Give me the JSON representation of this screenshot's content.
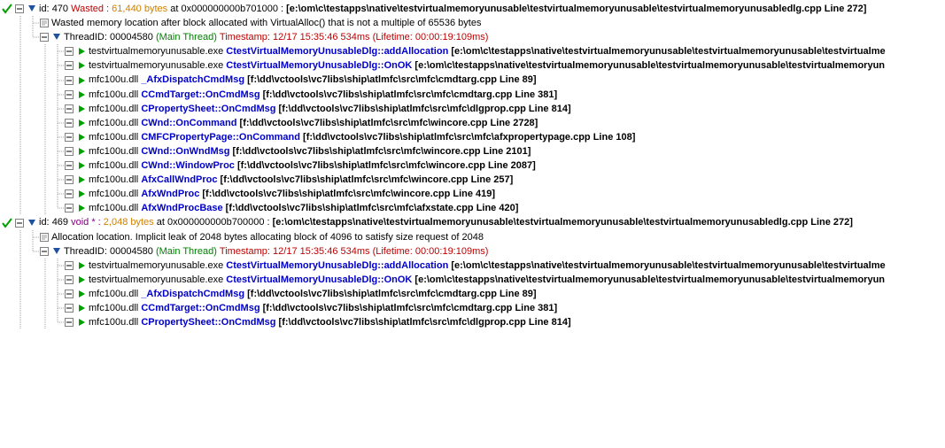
{
  "nodes": [
    {
      "id_label": "id: ",
      "id_no": "470",
      "waste_label": " Wasted : ",
      "bytes": "61,440 bytes",
      "at": " at ",
      "addr": "0x000000000b701000 : ",
      "loc": "[e:\\om\\c\\testapps\\native\\testvirtualmemoryunusable\\testvirtualmemoryunusable\\testvirtualmemoryunusabledlg.cpp Line 272]",
      "desc": "Wasted memory location after block allocated with VirtualAlloc() that is not a multiple of 65536 bytes",
      "thread_label": "ThreadID: ",
      "thread_id": "00004580",
      "thread_name": "  (Main Thread)  ",
      "ts_label": "Timestamp: ",
      "ts": "12/17 15:35:46 534ms",
      "life": " (Lifetime: 00:00:19:109ms)",
      "stack": [
        {
          "mod": "testvirtualmemoryunusable.exe ",
          "fn": "CtestVirtualMemoryUnusableDlg::addAllocation",
          "loc": "  [e:\\om\\c\\testapps\\native\\testvirtualmemoryunusable\\testvirtualmemoryunusable\\testvirtualme"
        },
        {
          "mod": "testvirtualmemoryunusable.exe ",
          "fn": "CtestVirtualMemoryUnusableDlg::OnOK",
          "loc": "  [e:\\om\\c\\testapps\\native\\testvirtualmemoryunusable\\testvirtualmemoryunusable\\testvirtualmemoryun"
        },
        {
          "mod": "mfc100u.dll ",
          "fn": "_AfxDispatchCmdMsg",
          "loc": "  [f:\\dd\\vctools\\vc7libs\\ship\\atlmfc\\src\\mfc\\cmdtarg.cpp Line 89]"
        },
        {
          "mod": "mfc100u.dll ",
          "fn": "CCmdTarget::OnCmdMsg",
          "loc": "  [f:\\dd\\vctools\\vc7libs\\ship\\atlmfc\\src\\mfc\\cmdtarg.cpp Line 381]"
        },
        {
          "mod": "mfc100u.dll ",
          "fn": "CPropertySheet::OnCmdMsg",
          "loc": "  [f:\\dd\\vctools\\vc7libs\\ship\\atlmfc\\src\\mfc\\dlgprop.cpp Line 814]"
        },
        {
          "mod": "mfc100u.dll ",
          "fn": "CWnd::OnCommand",
          "loc": "  [f:\\dd\\vctools\\vc7libs\\ship\\atlmfc\\src\\mfc\\wincore.cpp Line 2728]"
        },
        {
          "mod": "mfc100u.dll ",
          "fn": "CMFCPropertyPage::OnCommand",
          "loc": "  [f:\\dd\\vctools\\vc7libs\\ship\\atlmfc\\src\\mfc\\afxpropertypage.cpp Line 108]"
        },
        {
          "mod": "mfc100u.dll ",
          "fn": "CWnd::OnWndMsg",
          "loc": "  [f:\\dd\\vctools\\vc7libs\\ship\\atlmfc\\src\\mfc\\wincore.cpp Line 2101]"
        },
        {
          "mod": "mfc100u.dll ",
          "fn": "CWnd::WindowProc",
          "loc": "  [f:\\dd\\vctools\\vc7libs\\ship\\atlmfc\\src\\mfc\\wincore.cpp Line 2087]"
        },
        {
          "mod": "mfc100u.dll ",
          "fn": "AfxCallWndProc",
          "loc": "  [f:\\dd\\vctools\\vc7libs\\ship\\atlmfc\\src\\mfc\\wincore.cpp Line 257]"
        },
        {
          "mod": "mfc100u.dll ",
          "fn": "AfxWndProc",
          "loc": "  [f:\\dd\\vctools\\vc7libs\\ship\\atlmfc\\src\\mfc\\wincore.cpp Line 419]"
        },
        {
          "mod": "mfc100u.dll ",
          "fn": "AfxWndProcBase",
          "loc": "  [f:\\dd\\vctools\\vc7libs\\ship\\atlmfc\\src\\mfc\\afxstate.cpp Line 420]"
        }
      ]
    },
    {
      "id_label": "id: ",
      "id_no": "469",
      "void_label": " void * : ",
      "bytes": "2,048 bytes",
      "at": " at ",
      "addr": "0x000000000b700000 : ",
      "loc": "[e:\\om\\c\\testapps\\native\\testvirtualmemoryunusable\\testvirtualmemoryunusable\\testvirtualmemoryunusabledlg.cpp Line 272]",
      "desc": "Allocation location. Implicit leak of 2048 bytes allocating block of 4096 to satisfy size request of 2048",
      "thread_label": "ThreadID: ",
      "thread_id": "00004580",
      "thread_name": "  (Main Thread)  ",
      "ts_label": "Timestamp: ",
      "ts": "12/17 15:35:46 534ms",
      "life": " (Lifetime: 00:00:19:109ms)",
      "stack": [
        {
          "mod": "testvirtualmemoryunusable.exe ",
          "fn": "CtestVirtualMemoryUnusableDlg::addAllocation",
          "loc": "  [e:\\om\\c\\testapps\\native\\testvirtualmemoryunusable\\testvirtualmemoryunusable\\testvirtualme"
        },
        {
          "mod": "testvirtualmemoryunusable.exe ",
          "fn": "CtestVirtualMemoryUnusableDlg::OnOK",
          "loc": "  [e:\\om\\c\\testapps\\native\\testvirtualmemoryunusable\\testvirtualmemoryunusable\\testvirtualmemoryun"
        },
        {
          "mod": "mfc100u.dll ",
          "fn": "_AfxDispatchCmdMsg",
          "loc": "  [f:\\dd\\vctools\\vc7libs\\ship\\atlmfc\\src\\mfc\\cmdtarg.cpp Line 89]"
        },
        {
          "mod": "mfc100u.dll ",
          "fn": "CCmdTarget::OnCmdMsg",
          "loc": "  [f:\\dd\\vctools\\vc7libs\\ship\\atlmfc\\src\\mfc\\cmdtarg.cpp Line 381]"
        },
        {
          "mod": "mfc100u.dll ",
          "fn": "CPropertySheet::OnCmdMsg",
          "loc": "  [f:\\dd\\vctools\\vc7libs\\ship\\atlmfc\\src\\mfc\\dlgprop.cpp Line 814]"
        }
      ]
    }
  ]
}
